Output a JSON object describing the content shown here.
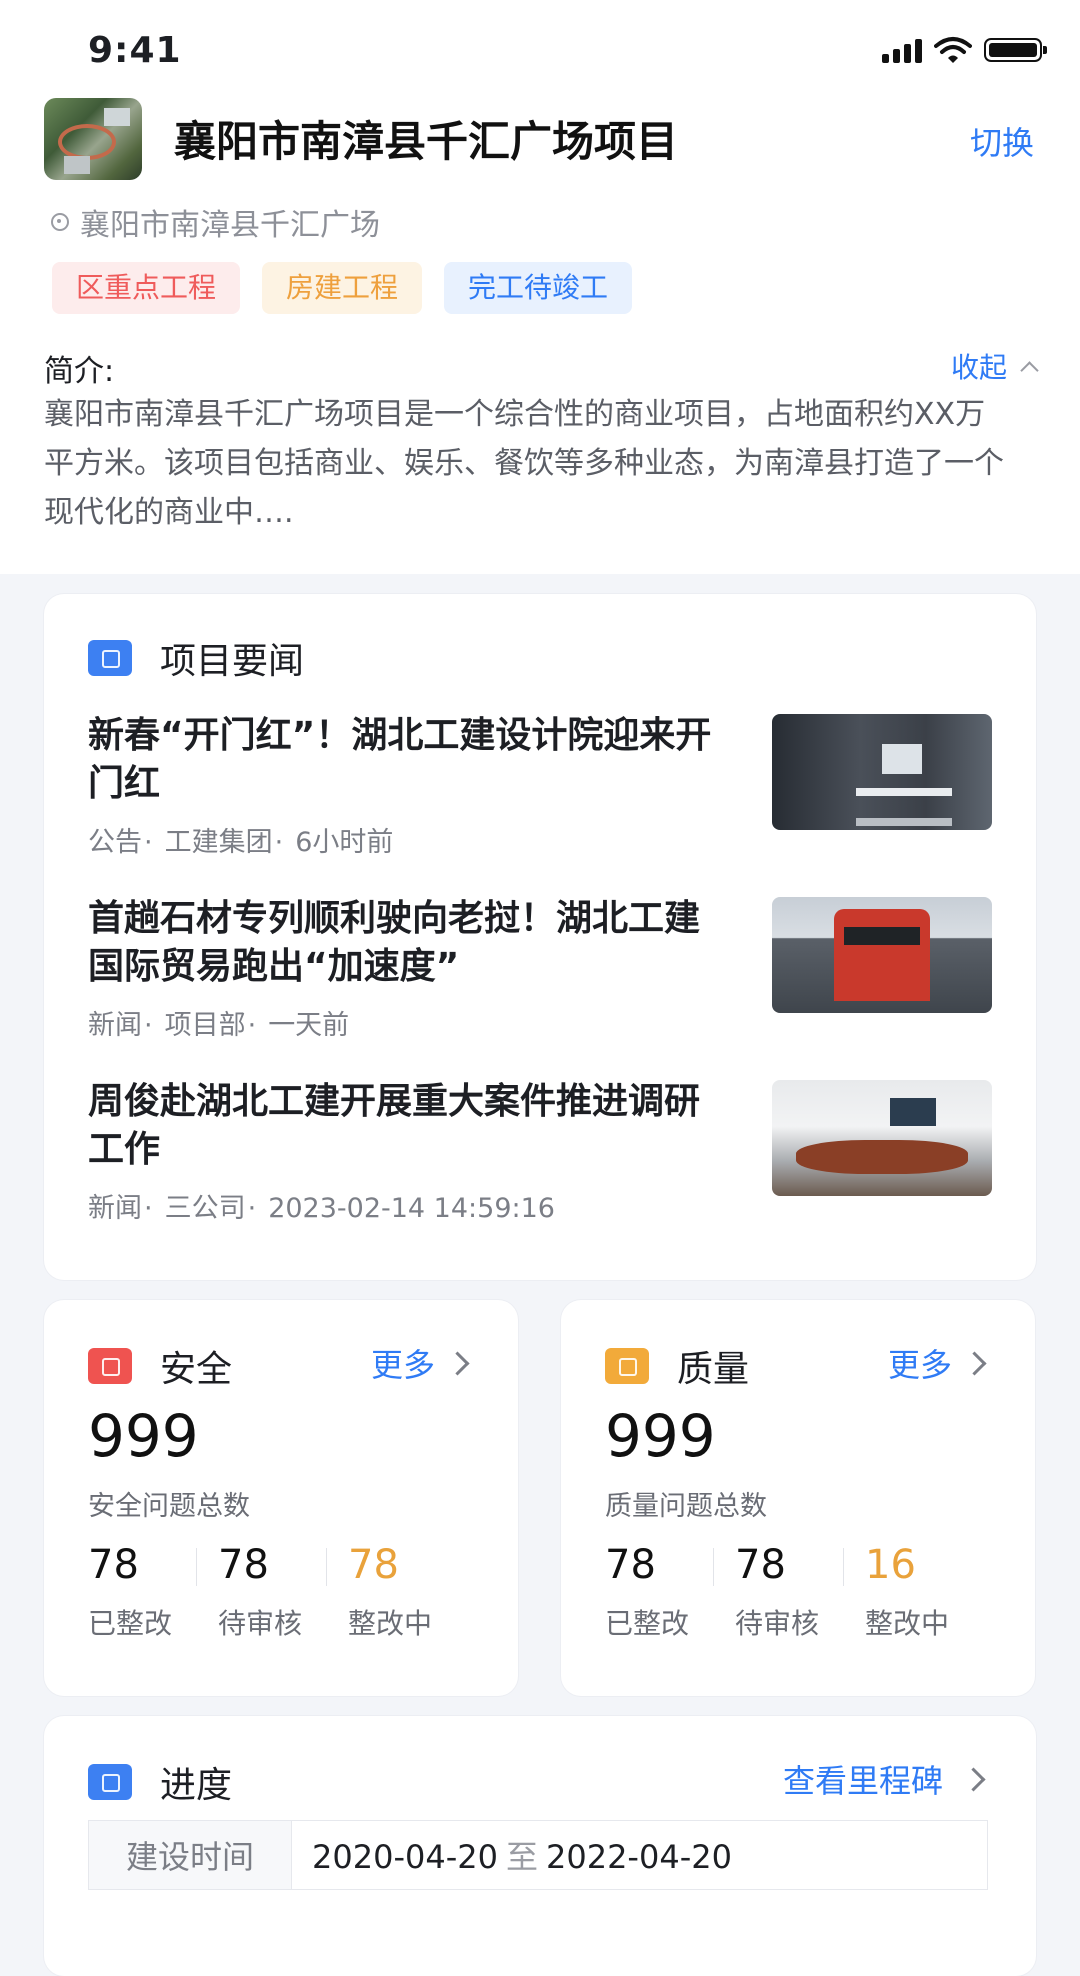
{
  "status_bar": {
    "time": "9:41"
  },
  "project": {
    "title": "襄阳市南漳县千汇广场项目",
    "switch_label": "切换",
    "address": "襄阳市南漳县千汇广场",
    "tags": [
      "区重点工程",
      "房建工程",
      "完工待竣工"
    ],
    "intro_label": "简介:",
    "collapse_label": "收起",
    "intro_text": "襄阳市南漳县千汇广场项目是一个综合性的商业项目，占地面积约XX万平方米。该项目包括商业、娱乐、餐饮等多种业态，为南漳县打造了一个现代化的商业中…."
  },
  "news": {
    "title": "项目要闻",
    "items": [
      {
        "title": "新春“开门红”！湖北工建设计院迎来开门红",
        "type": "公告",
        "source": "工建集团",
        "time": "6小时前"
      },
      {
        "title": "首趟石材专列顺利驶向老挝！湖北工建国际贸易跑出“加速度”",
        "type": "新闻",
        "source": "项目部",
        "time": "一天前"
      },
      {
        "title": "周俊赴湖北工建开展重大案件推进调研工作",
        "type": "新闻",
        "source": "三公司",
        "time": "2023-02-14 14:59:16"
      }
    ]
  },
  "safety": {
    "title": "安全",
    "more": "更多",
    "total": "999",
    "total_label": "安全问题总数",
    "stats": [
      {
        "value": "78",
        "label": "已整改"
      },
      {
        "value": "78",
        "label": "待审核"
      },
      {
        "value": "78",
        "label": "整改中"
      }
    ]
  },
  "quality": {
    "title": "质量",
    "more": "更多",
    "total": "999",
    "total_label": "质量问题总数",
    "stats": [
      {
        "value": "78",
        "label": "已整改"
      },
      {
        "value": "78",
        "label": "待审核"
      },
      {
        "value": "16",
        "label": "整改中"
      }
    ]
  },
  "progress": {
    "title": "进度",
    "milestone_link": "查看里程碑",
    "rows": [
      {
        "label": "建设时间",
        "start": "2020-04-20",
        "to": "至",
        "end": "2022-04-20"
      }
    ]
  },
  "colors": {
    "accent": "#2f7bf5",
    "safety_icon": "#ef5350",
    "quality_icon": "#f2aa3a",
    "warning_number": "#e9a23b"
  }
}
